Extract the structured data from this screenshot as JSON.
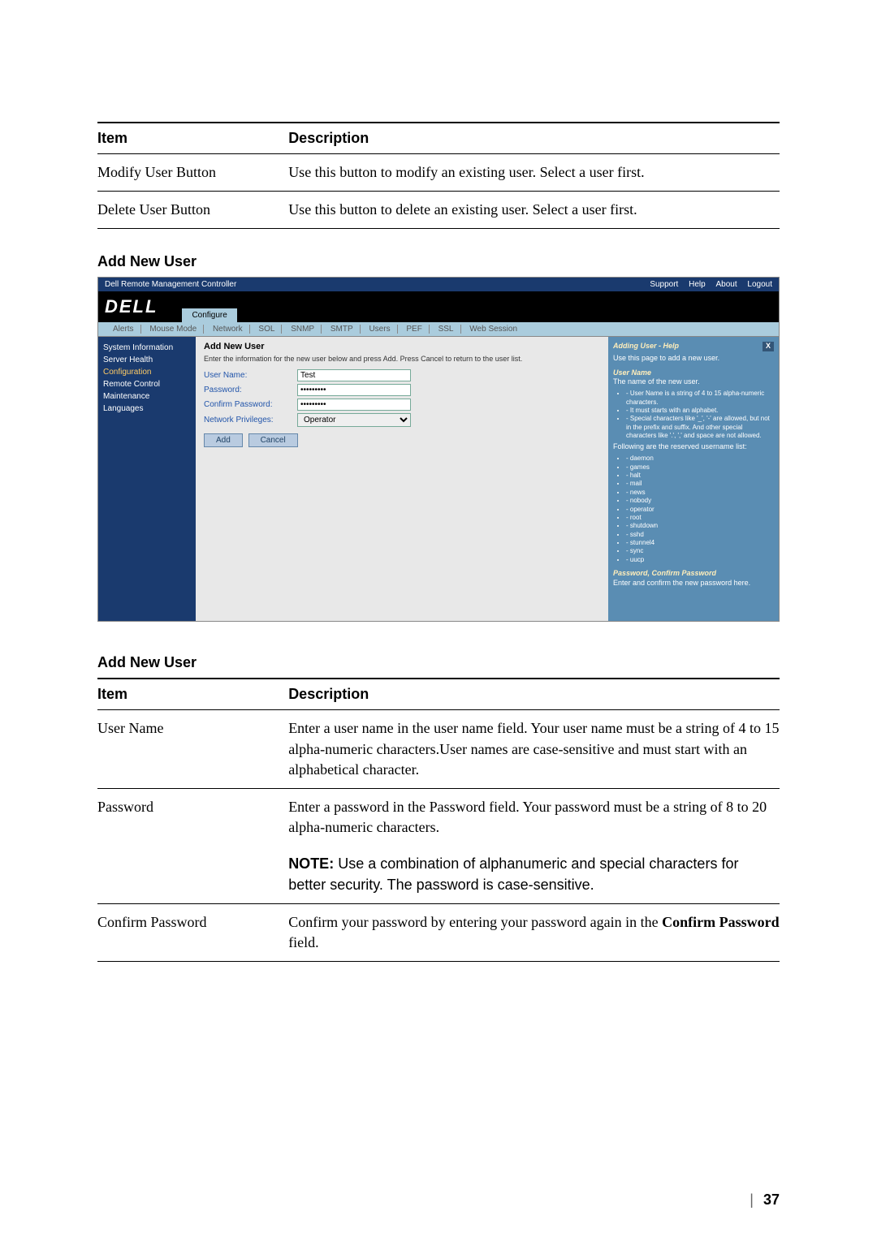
{
  "table1": {
    "headers": {
      "item": "Item",
      "desc": "Description"
    },
    "rows": [
      {
        "item": "Modify User Button",
        "desc": "Use this button to modify an existing user. Select a user first."
      },
      {
        "item": "Delete User Button",
        "desc": "Use this button to delete an existing user. Select a user first."
      }
    ]
  },
  "section_title_1": "Add New User",
  "screenshot": {
    "titlebar_left": "Dell Remote Management Controller",
    "titlebar_links": [
      "Support",
      "Help",
      "About",
      "Logout"
    ],
    "logo": "DELL",
    "main_tab": "Configure",
    "subtabs": [
      "Alerts",
      "Mouse Mode",
      "Network",
      "SOL",
      "SNMP",
      "SMTP",
      "Users",
      "PEF",
      "SSL",
      "Web Session"
    ],
    "sidebar": {
      "items": [
        "System Information",
        "Server Health",
        "Configuration",
        "Remote Control",
        "Maintenance",
        "Languages"
      ],
      "active_index": 2
    },
    "main": {
      "title": "Add New User",
      "instruction": "Enter the information for the new user below and press Add. Press Cancel to return to the user list.",
      "fields": {
        "username_label": "User Name:",
        "username_value": "Test",
        "password_label": "Password:",
        "password_value": "•••••••••",
        "confirm_label": "Confirm Password:",
        "confirm_value": "•••••••••",
        "priv_label": "Network Privileges:",
        "priv_value": "Operator"
      },
      "buttons": {
        "add": "Add",
        "cancel": "Cancel"
      }
    },
    "help": {
      "title": "Adding User - Help",
      "close": "X",
      "intro": "Use this page to add a new user.",
      "section_user": "User Name",
      "user_desc": "The name of the new user.",
      "user_bullets": [
        "- User Name is a string of 4 to 15 alpha-numeric characters.",
        "- It must starts with an alphabet.",
        "- Special characters like '_', '-' are allowed, but not in the prefix and suffix. And other special characters like '.', ',' and space are not allowed."
      ],
      "reserved_intro": "Following are the reserved username list:",
      "reserved_list": [
        "- daemon",
        "- games",
        "- halt",
        "- mail",
        "- news",
        "- nobody",
        "- operator",
        "- root",
        "- shutdown",
        "- sshd",
        "- stunnel4",
        "- sync",
        "- uucp"
      ],
      "section_pw": "Password, Confirm Password",
      "pw_desc": "Enter and confirm the new password here."
    }
  },
  "section_title_2": "Add New User",
  "table2": {
    "headers": {
      "item": "Item",
      "desc": "Description"
    },
    "rows": [
      {
        "item": "User Name",
        "desc": "Enter a user name in the user name field. Your user name must be a string of 4 to 15 alpha-numeric characters.User names are case-sensitive and must start with an alphabetical character."
      },
      {
        "item": "Password",
        "desc": "Enter a password in the Password field. Your password must be a string of 8 to 20 alpha-numeric characters.",
        "note_label": "NOTE:",
        "note": " Use a combination of alphanumeric and special characters for better security. The password is case-sensitive."
      },
      {
        "item": "Confirm Password",
        "desc_prefix": "Confirm your password by entering your password again in the ",
        "desc_bold": "Confirm Password",
        "desc_suffix": " field."
      }
    ]
  },
  "page_number": "37"
}
